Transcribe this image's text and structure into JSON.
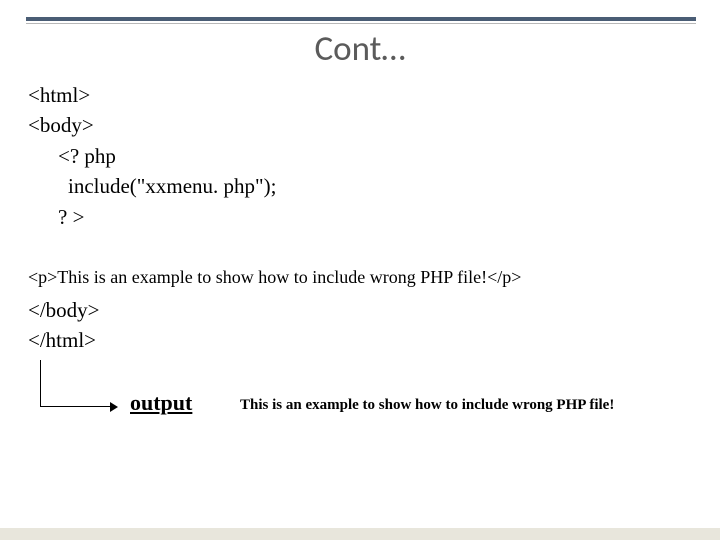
{
  "title": "Cont…",
  "code": {
    "line1": "<html>",
    "line2": "<body>",
    "line3": "<? php",
    "line4": "include(\"xxmenu. php\");",
    "line5": "? >",
    "line6": "<p>This is an example to show how to include wrong PHP file!</p>",
    "line7": "</body>",
    "line8": "</html>"
  },
  "output": {
    "label": "output",
    "text": "This is an example to show how to include wrong PHP file!"
  }
}
